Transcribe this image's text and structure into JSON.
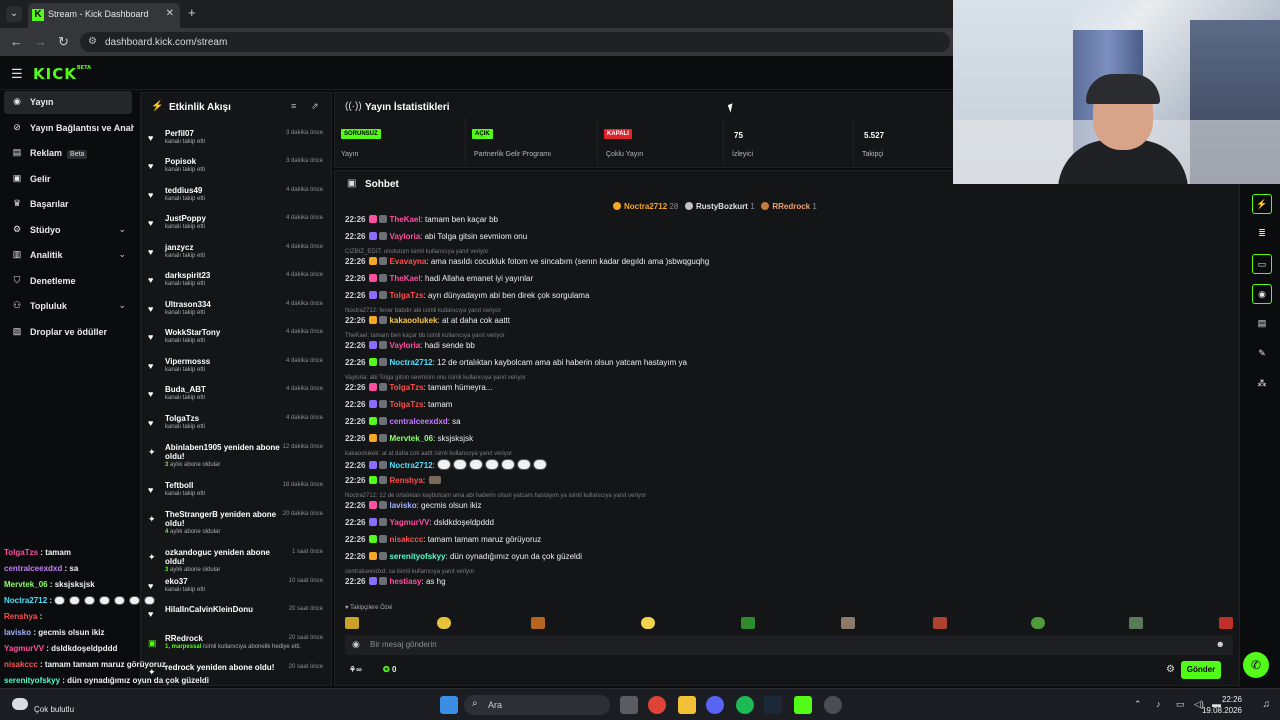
{
  "browser": {
    "tab_title": "Stream - Kick Dashboard",
    "url": "dashboard.kick.com/stream"
  },
  "logo": {
    "text": "KICK",
    "tag": "BETA"
  },
  "sidebar": {
    "items": [
      {
        "label": "Yayın",
        "icon": "broadcast-icon",
        "active": true
      },
      {
        "label": "Yayın Bağlantısı ve Anahtarı",
        "icon": "link-icon"
      },
      {
        "label": "Reklam",
        "icon": "ad-icon",
        "badge": "Beta"
      },
      {
        "label": "Gelir",
        "icon": "dollar-icon"
      },
      {
        "label": "Başarılar",
        "icon": "trophy-icon"
      },
      {
        "label": "Stüdyo",
        "icon": "studio-icon",
        "expandable": true
      },
      {
        "label": "Analitik",
        "icon": "chart-icon",
        "expandable": true
      },
      {
        "label": "Denetleme",
        "icon": "shield-icon"
      },
      {
        "label": "Topluluk",
        "icon": "community-icon",
        "expandable": true
      },
      {
        "label": "Droplar ve ödüller",
        "icon": "gift-icon"
      }
    ]
  },
  "activity": {
    "title": "Etkinlik Akışı",
    "items": [
      {
        "name": "Perfil07",
        "sub": "kanalı takip etti",
        "time": "3 dakika önce",
        "icon": "heart"
      },
      {
        "name": "Popisok",
        "sub": "kanalı takip etti",
        "time": "3 dakika önce",
        "icon": "heart"
      },
      {
        "name": "teddius49",
        "sub": "kanalı takip etti",
        "time": "4 dakika önce",
        "icon": "heart"
      },
      {
        "name": "JustPoppy",
        "sub": "kanalı takip etti",
        "time": "4 dakika önce",
        "icon": "heart"
      },
      {
        "name": "janzycz",
        "sub": "kanalı takip etti",
        "time": "4 dakika önce",
        "icon": "heart"
      },
      {
        "name": "darkspirit23",
        "sub": "kanalı takip etti",
        "time": "4 dakika önce",
        "icon": "heart"
      },
      {
        "name": "Ultrason334",
        "sub": "kanalı takip etti",
        "time": "4 dakika önce",
        "icon": "heart"
      },
      {
        "name": "WokkStarTony",
        "sub": "kanalı takip etti",
        "time": "4 dakika önce",
        "icon": "heart"
      },
      {
        "name": "Vipermosss",
        "sub": "kanalı takip etti",
        "time": "4 dakika önce",
        "icon": "heart"
      },
      {
        "name": "Buda_ABT",
        "sub": "kanalı takip etti",
        "time": "4 dakika önce",
        "icon": "heart"
      },
      {
        "name": "TolgaTzs",
        "sub": "kanalı takip etti",
        "time": "4 dakika önce",
        "icon": "heart"
      },
      {
        "name": "Abinlaben1905 yeniden abone oldu!",
        "sub_count": "3",
        "sub": "aylık abone oldular",
        "time": "12 dakika önce",
        "icon": "star"
      },
      {
        "name": "Teftboll",
        "sub": "kanalı takip etti",
        "time": "18 dakika önce",
        "icon": "heart"
      },
      {
        "name": "TheStrangerB yeniden abone oldu!",
        "sub_count": "4",
        "sub": "aylık abone oldular",
        "time": "20 dakika önce",
        "icon": "star"
      },
      {
        "name": "ozkandoguc yeniden abone oldu!",
        "sub_count": "3",
        "sub": "aylık abone oldular",
        "time": "1 saat önce",
        "icon": "star"
      },
      {
        "name": "eko37",
        "sub": "kanalı takip etti",
        "time": "10 saat önce",
        "icon": "heart"
      },
      {
        "name": "HilalInCalvinKleinDonu",
        "sub": "",
        "time": "20 saat önce",
        "icon": "heart"
      },
      {
        "name": "RRedrock",
        "sub_count": "1, marpessal",
        "sub": "isimli kullanıcıya abonelik hediye etti.",
        "time": "20 saat önce",
        "icon": "gift"
      },
      {
        "name": "redrock yeniden abone oldu!",
        "sub": "",
        "time": "20 saat önce",
        "icon": "star"
      }
    ]
  },
  "stats": {
    "title": "Yayın İstatistikleri",
    "cards": [
      {
        "badge": "SORUNSUZ",
        "label": "Yayın",
        "badge_color": "#53fc18",
        "badge_text_color": "#000000"
      },
      {
        "badge": "AÇIK",
        "label": "Partnerlik Gelir Programı",
        "badge_color": "#53fc18",
        "badge_text_color": "#000000"
      },
      {
        "badge": "KAPALI",
        "label": "Çoklu Yayın",
        "badge_color": "#e0242e",
        "badge_text_color": "#ffffff"
      },
      {
        "value": "75",
        "label": "İzleyici"
      },
      {
        "value": "5.527",
        "label": "Takipçi"
      }
    ]
  },
  "chat": {
    "title": "Sohbet",
    "top_chatters": [
      {
        "name": "Noctra2712",
        "count": "28",
        "color": "#f5a623"
      },
      {
        "name": "RustyBozkurt",
        "count": "1",
        "color": "#bfc3c8"
      },
      {
        "name": "RRedrock",
        "count": "1",
        "color": "#c77b3a"
      }
    ],
    "messages": [
      {
        "time": "22:26",
        "user": "TheKael",
        "color": "#ff4fa0",
        "text": ": tamam ben kaçar bb"
      },
      {
        "time": "22:26",
        "user": "Vayloria",
        "color": "#ff4fa0",
        "text": ": abi Tolga gitsin sevmiom onu"
      },
      {
        "reply": "CIZBIZ_EDIT: unuturum isimli kullanıcıya yanıt veriyor"
      },
      {
        "time": "22:26",
        "user": "Evavayna",
        "color": "#ff4f4f",
        "text": ": ama nasıldı cocukluk fotom ve sincabım (senın kadar degıldı ama )sbwqguqhg"
      },
      {
        "time": "22:26",
        "user": "TheKael",
        "color": "#ff4fa0",
        "text": ": hadi Allaha emanet iyi yayınlar"
      },
      {
        "time": "22:26",
        "user": "TolgaTzs",
        "color": "#ff4f4f",
        "text": ": ayrı dünyadayım abi ben direk çok sorgulama"
      },
      {
        "reply": "Noctra2712: fener babdır abi isimli kullanıcıya yanıt veriyor"
      },
      {
        "time": "22:26",
        "user": "kakaoolukek",
        "color": "#f7c948",
        "text": ": at at daha cok aattt"
      },
      {
        "reply": "TheKael: tamam ben kaçar bb isimli kullanıcıya yanıt veriyor"
      },
      {
        "time": "22:26",
        "user": "Vayloria",
        "color": "#ff4fa0",
        "text": ": hadi sende bb"
      },
      {
        "time": "22:26",
        "user": "Noctra2712",
        "color": "#4fe0ff",
        "text": ": 12 de ortalıktan kaybolcam ama abi haberin olsun yatcam hastayım ya"
      },
      {
        "reply": "Vayloria: abi Tolga gitsin sevmiom onu isimli kullanıcıya yanıt veriyor"
      },
      {
        "time": "22:26",
        "user": "TolgaTzs",
        "color": "#ff4f4f",
        "text": ": tamam hümeyra..."
      },
      {
        "time": "22:26",
        "user": "TolgaTzs",
        "color": "#ff4f4f",
        "text": ": tamam"
      },
      {
        "time": "22:26",
        "user": "centralceexdxd",
        "color": "#c77bff",
        "text": ": sa"
      },
      {
        "time": "22:26",
        "user": "Mervtek_06",
        "color": "#8cff6b",
        "text": ": sksjsksjsk"
      },
      {
        "reply": "kakaoolukek: at at daha cok aattt isimli kullanıcıya yanıt veriyor"
      },
      {
        "time": "22:26",
        "user": "Noctra2712",
        "color": "#4fe0ff",
        "text": ": "
      },
      {
        "time": "22:26",
        "user": "Renshya",
        "color": "#ff4f4f",
        "text": ": "
      },
      {
        "reply": "Noctra2712: 12 de ortalıktan kaybolcam ama abi haberin olsun yatcam hastayım ya isimli kullanıcıya yanıt veriyor"
      },
      {
        "time": "22:26",
        "user": "lavisko",
        "color": "#a5b4ff",
        "text": ": gecmis olsun ikiz"
      },
      {
        "time": "22:26",
        "user": "YagmurVV",
        "color": "#ff4fa0",
        "text": ": dsldkdoşeldpddd"
      },
      {
        "time": "22:26",
        "user": "nisakccc",
        "color": "#ff4f4f",
        "text": ": tamam tamam maruz görüyoruz"
      },
      {
        "time": "22:26",
        "user": "serenityofskyy",
        "color": "#4fffc8",
        "text": ": dün oynadığımız oyun da çok güzeldi"
      },
      {
        "reply": "centralceexdxd: sa isimli kullanıcıya yanıt veriyor"
      },
      {
        "time": "22:26",
        "user": "hestiasy",
        "color": "#ff4fa0",
        "text": ": as hg"
      }
    ],
    "follower_only": "Takipçilere Özel",
    "input_placeholder": "Bir mesaj gönderin",
    "footer_count": "0",
    "send_label": "Gönder"
  },
  "overlay_chat": [
    {
      "user": "TolgaTzs",
      "color": "#ff4fa0",
      "text": " : tamam"
    },
    {
      "user": "centralceexdxd",
      "color": "#c77bff",
      "text": " : sa"
    },
    {
      "user": "Mervtek_06",
      "color": "#8cff6b",
      "text": " : sksjsksjsk"
    },
    {
      "user": "Noctra2712",
      "color": "#4fe0ff",
      "text": " :"
    },
    {
      "user": "Renshya",
      "color": "#ff4f4f",
      "text": " :"
    },
    {
      "user": "lavisko",
      "color": "#a5b4ff",
      "text": " : gecmis olsun ikiz"
    },
    {
      "user": "YagmurVV",
      "color": "#ff4fa0",
      "text": " : dsldkdoşeldpddd"
    },
    {
      "user": "nisakccc",
      "color": "#ff4f4f",
      "text": " : tamam tamam maruz görüyoruz"
    },
    {
      "user": "serenityofskyy",
      "color": "#4fffc8",
      "text": " : dün oynadığımız oyun da çok güzeldi"
    },
    {
      "user": "hestiasy",
      "color": "#ff4fa0",
      "text": " : as hg"
    }
  ],
  "taskbar": {
    "weather": "Çok bulutlu",
    "search": "Ara",
    "time": "22:26",
    "date": "19.08.2026"
  }
}
